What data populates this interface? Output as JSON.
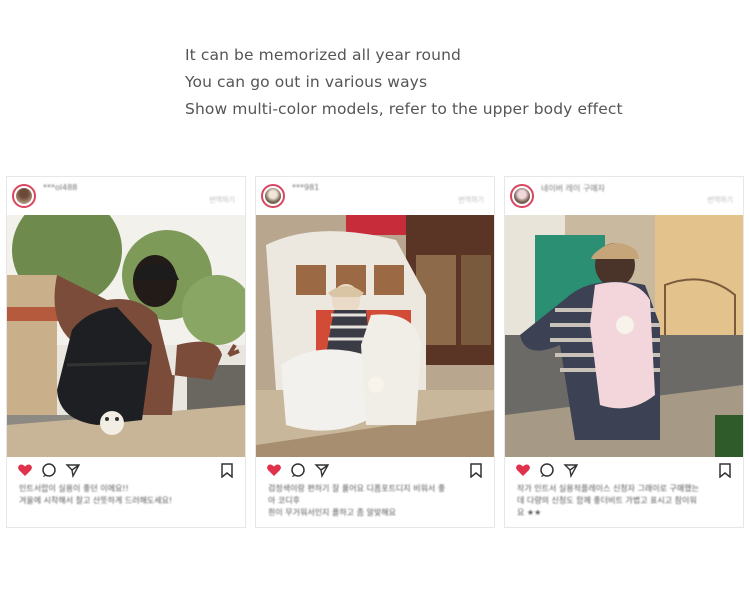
{
  "intro": {
    "lines": [
      "It can be memorized all year round",
      "You can go out in various ways",
      "Show multi-color models, refer to the upper body effect"
    ]
  },
  "posts": [
    {
      "handle": "***ol488",
      "more": "번역하기",
      "caption_line1": "인트서랍이 실용이 좋던 이에요!!",
      "caption_line2": "겨울에 시착해서 찰고 산뜻하게 드러해도세요!"
    },
    {
      "handle": "***981",
      "more": "번역하기",
      "caption_line1": "검정색이랑 편하기 잘 풀어요 디폼포트디지 비워서 좋",
      "caption_line2": "아 코디후",
      "caption_line3": "흰이 무거워서인지 폴하고 좀 알맞해요"
    },
    {
      "handle": "네이버 레이 구매자",
      "more": "번역하기",
      "caption_line1": "작가 인트서 실용적플레이스 신청자 그래이로 구매했는",
      "caption_line2": "데 다량의 신청도 함께 좋더비트 가볍고 표시고 참이워",
      "caption_line3": "요 ★★"
    }
  ],
  "colors": {
    "like_red": "#e0334b",
    "icon_dark": "#333333",
    "avatar_ring": "#d9455f"
  },
  "icons": [
    "heart-icon",
    "comment-icon",
    "share-icon",
    "bookmark-icon"
  ]
}
